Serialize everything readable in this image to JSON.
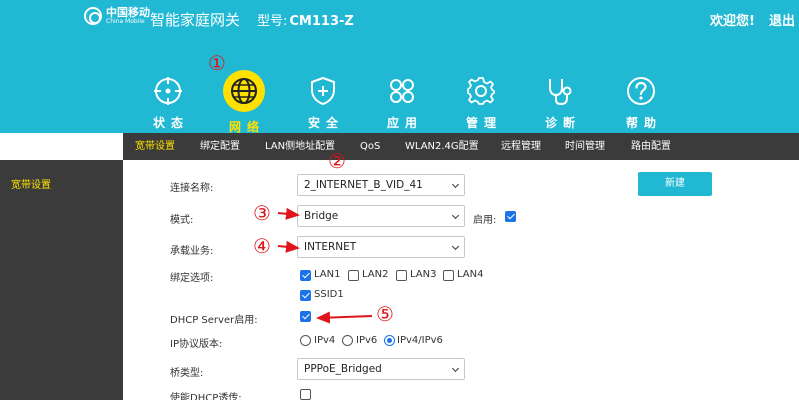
{
  "header": {
    "logo_cn": "中国移动",
    "logo_en": "China Mobile",
    "product_title": "智能家庭网关",
    "model_label": "型号:",
    "model_value": "CM113-Z",
    "welcome": "欢迎您!",
    "logout": "退出"
  },
  "nav": [
    {
      "label": "状态",
      "icon": "crosshair-icon",
      "active": false
    },
    {
      "label": "网络",
      "icon": "globe-icon",
      "active": true
    },
    {
      "label": "安全",
      "icon": "shield-icon",
      "active": false
    },
    {
      "label": "应用",
      "icon": "apps-grid-icon",
      "active": false
    },
    {
      "label": "管理",
      "icon": "gear-icon",
      "active": false
    },
    {
      "label": "诊断",
      "icon": "stethoscope-icon",
      "active": false
    },
    {
      "label": "帮助",
      "icon": "help-icon",
      "active": false
    }
  ],
  "annotations": [
    "①",
    "②",
    "③",
    "④",
    "⑤"
  ],
  "subnav": [
    {
      "label": "宽带设置",
      "active": true
    },
    {
      "label": "绑定配置",
      "active": false
    },
    {
      "label": "LAN侧地址配置",
      "active": false
    },
    {
      "label": "QoS",
      "active": false
    },
    {
      "label": "WLAN2.4G配置",
      "active": false
    },
    {
      "label": "远程管理",
      "active": false
    },
    {
      "label": "时间管理",
      "active": false
    },
    {
      "label": "路由配置",
      "active": false
    }
  ],
  "sidebar": {
    "items": [
      {
        "label": "宽带设置",
        "active": true
      }
    ]
  },
  "form": {
    "connection_name": {
      "label": "连接名称:",
      "value": "2_INTERNET_B_VID_41"
    },
    "mode": {
      "label": "模式:",
      "value": "Bridge",
      "enable_label": "启用:",
      "enable_checked": true
    },
    "service": {
      "label": "承载业务:",
      "value": "INTERNET"
    },
    "binding": {
      "label": "绑定选项:",
      "options": [
        {
          "label": "LAN1",
          "checked": true
        },
        {
          "label": "LAN2",
          "checked": false
        },
        {
          "label": "LAN3",
          "checked": false
        },
        {
          "label": "LAN4",
          "checked": false
        },
        {
          "label": "SSID1",
          "checked": true
        }
      ]
    },
    "dhcp_server": {
      "label": "DHCP Server启用:",
      "checked": true
    },
    "ip_version": {
      "label": "IP协议版本:",
      "options": [
        {
          "label": "IPv4",
          "selected": false
        },
        {
          "label": "IPv6",
          "selected": false
        },
        {
          "label": "IPv4/IPv6",
          "selected": true
        }
      ]
    },
    "bridge_type": {
      "label": "桥类型:",
      "value": "PPPoE_Bridged"
    },
    "dhcp_passthrough": {
      "label": "使能DHCP透传:",
      "checked": false
    },
    "new_button": "新建"
  },
  "colors": {
    "header": "#21b8d4",
    "dark": "#3b3b3b",
    "accent_yellow": "#ffe100",
    "annotation_red": "#e0151b",
    "check_blue": "#1a73e8"
  }
}
